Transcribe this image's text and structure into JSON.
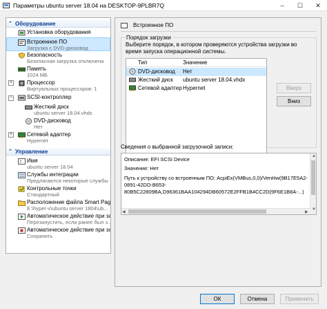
{
  "window": {
    "title": "Параметры ubuntu server 18.04 на DESKTOP-9PLBR7Q",
    "controls": [
      "–",
      "☐",
      "✕"
    ]
  },
  "nav": {
    "hardware_section": "Оборудование",
    "management_section": "Управление",
    "items": [
      {
        "label": "Установка оборудования",
        "sub": ""
      },
      {
        "label": "Встроенное ПО",
        "sub": "Загрузка с DVD-дисковод"
      },
      {
        "label": "Безопасность",
        "sub": "Безопасная загрузка отключена"
      },
      {
        "label": "Память",
        "sub": "1024 МБ"
      },
      {
        "label": "Процессор",
        "sub": "Виртуальных процессоров: 1"
      },
      {
        "label": "SCSI-контроллер",
        "sub": ""
      },
      {
        "label": "Жесткий диск",
        "sub": "ubuntu server 18.04.vhdx"
      },
      {
        "label": "DVD-дисковод",
        "sub": "Нет"
      },
      {
        "label": "Сетевой адаптер",
        "sub": "Hypernet"
      },
      {
        "label": "Имя",
        "sub": "ubuntu server 18.04"
      },
      {
        "label": "Службы интеграции",
        "sub": "Предлагаются некоторые службы"
      },
      {
        "label": "Контрольные точки",
        "sub": "Стандартный"
      },
      {
        "label": "Расположение файла Smart Paging",
        "sub": "E:\\hyper-v\\ubuntu server 1804\\ub..."
      },
      {
        "label": "Автоматическое действие при за...",
        "sub": "Перезапустить, если ранее был з..."
      },
      {
        "label": "Автоматическое действие при за...",
        "sub": "Сохранить"
      }
    ]
  },
  "panel": {
    "header": "Встроенное ПО",
    "boot_order_title": "Порядок загрузки",
    "description": "Выберите порядок, в котором проверяются устройства загрузки во время запуска операционной системы.",
    "columns": {
      "type": "Тип",
      "value": "Значение"
    },
    "boot_devices": [
      {
        "type": "DVD-дисковод",
        "value": "Нет"
      },
      {
        "type": "Жесткий диск",
        "value": "ubuntu server 18.04.vhdx"
      },
      {
        "type": "Сетевой адаптер",
        "value": "Hypernet"
      }
    ],
    "up_button": "Вверх",
    "down_button": "Вниз",
    "details_title": "Сведения о выбранной загрузочной записи:",
    "details": {
      "line1": "Описание: EFI SCSI Device",
      "line2": "Значение: Нет",
      "line3": "Путь к устройству со встроенным ПО: AcpiEx(VMBus,0,0)/VenHw(9B17E5A2-",
      "line4": "0891-42DD-B653-",
      "line5": "80B5C22809BA,D96361BAA104294DB60572E2FFB1B4CC2D(9F6E1B8A-...)"
    }
  },
  "footer": {
    "ok": "ОК",
    "cancel": "Отмена",
    "apply": "Применить"
  },
  "colors": {
    "selection": "#cde8ff",
    "accent": "#0078d7",
    "section_text": "#0b3d91"
  }
}
